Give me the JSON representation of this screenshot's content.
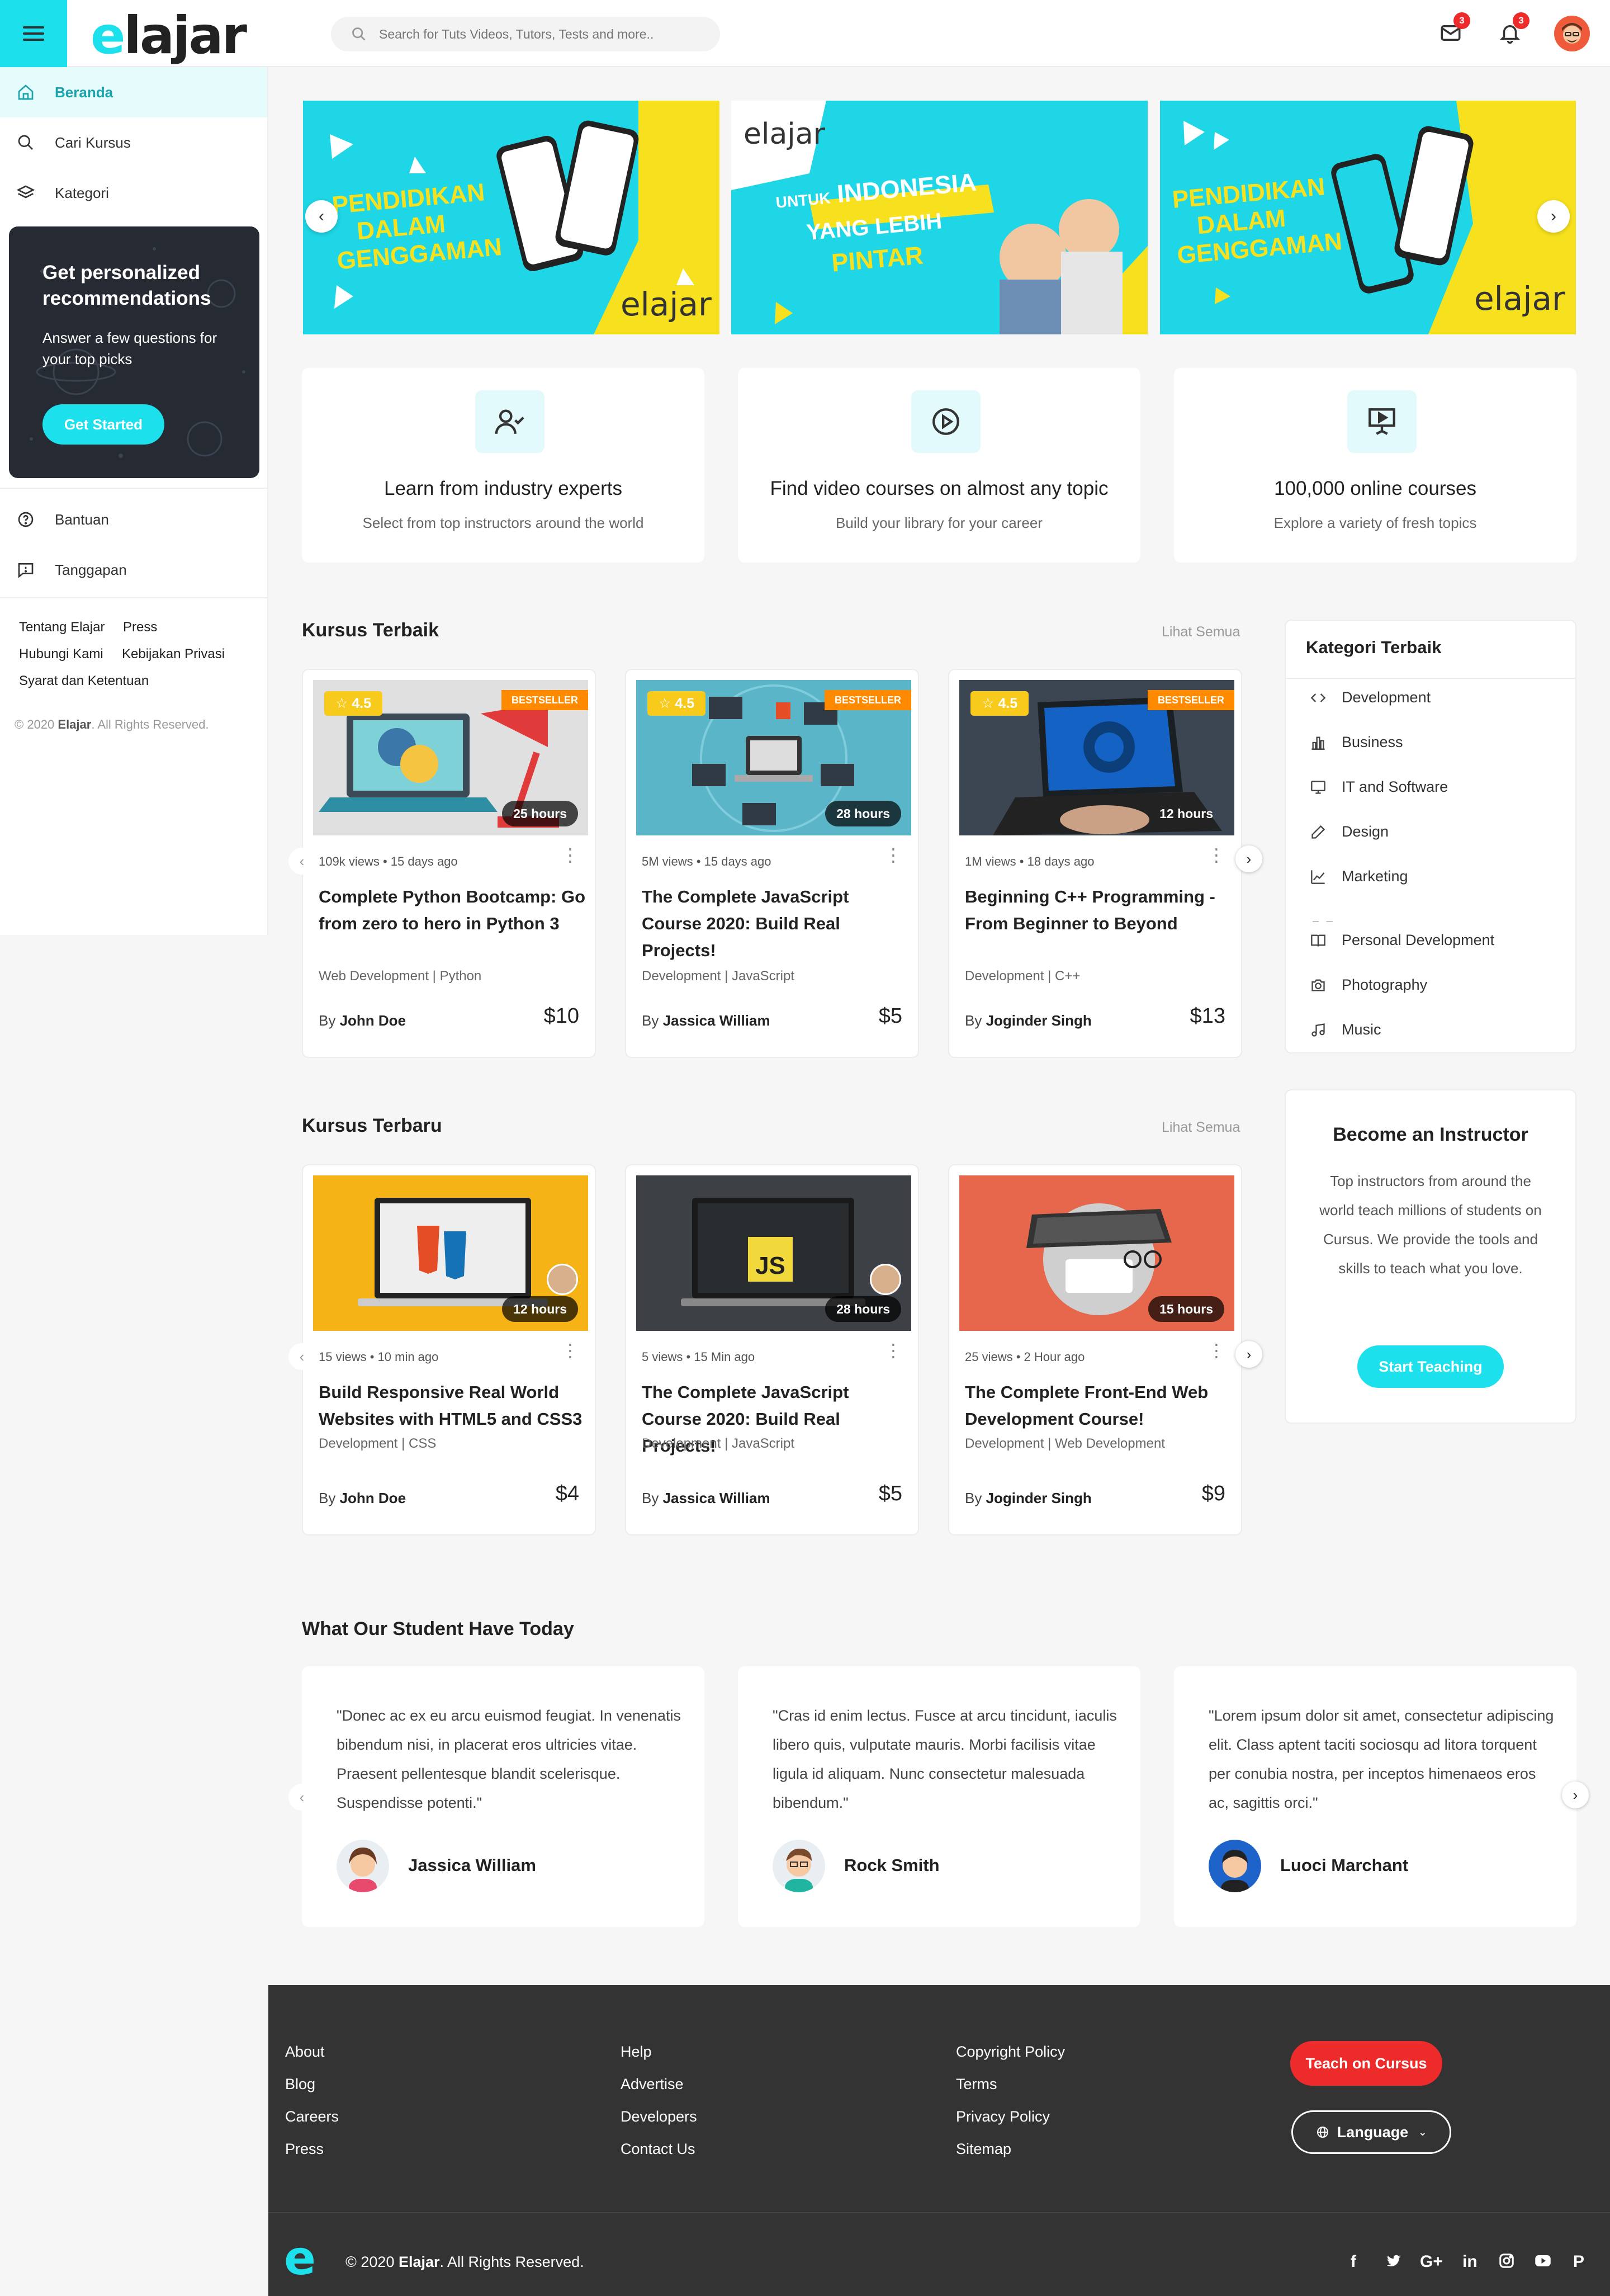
{
  "header": {
    "logo_e": "e",
    "logo_rest": "lajar",
    "search_placeholder": "Search for Tuts Videos, Tutors, Tests and more..",
    "mail_count": "3",
    "notif_count": "3"
  },
  "sidebar": {
    "nav": [
      {
        "label": "Beranda",
        "icon": "home-icon"
      },
      {
        "label": "Cari Kursus",
        "icon": "search-icon"
      },
      {
        "label": "Kategori",
        "icon": "layers-icon"
      }
    ],
    "promo": {
      "title": "Get personalized recommendations",
      "text": "Answer a few questions for your top picks",
      "button": "Get Started"
    },
    "nav2": [
      {
        "label": "Bantuan",
        "icon": "help-icon"
      },
      {
        "label": "Tanggapan",
        "icon": "feedback-icon"
      }
    ],
    "links": [
      "Tentang Elajar",
      "Press",
      "Hubungi Kami",
      "Kebijakan Privasi",
      "Syarat dan Ketentuan"
    ],
    "copyright_pre": "© 2020 ",
    "copyright_brand": "Elajar",
    "copyright_post": ". All Rights Reserved."
  },
  "banners": [
    {
      "line1": "PENDIDIKAN",
      "line2": "DALAM",
      "line3": "GENGGAMAN",
      "brand": "elajar"
    },
    {
      "brand": "elajar",
      "small": "UNTUK",
      "line1": "INDONESIA",
      "line2": "YANG LEBIH",
      "line3": "PINTAR"
    },
    {
      "line1": "PENDIDIKAN",
      "line2": "DALAM",
      "line3": "GENGGAMAN",
      "brand": "elajar"
    }
  ],
  "features": [
    {
      "title": "Learn from industry experts",
      "text": "Select from top instructors around the world",
      "icon": "user-check-icon"
    },
    {
      "title": "Find video courses on almost any topic",
      "text": "Build your library for your career",
      "icon": "play-circle-icon"
    },
    {
      "title": "100,000 online courses",
      "text": "Explore a variety of fresh topics",
      "icon": "presentation-icon"
    }
  ],
  "best": {
    "title": "Kursus Terbaik",
    "see_all": "Lihat Semua",
    "courses": [
      {
        "rating": "4.5",
        "badge": "BESTSELLER",
        "hours": "25 hours",
        "views": "109k views",
        "ago": "15 days ago",
        "title": "Complete Python Bootcamp: Go from zero to hero in Python 3",
        "category": "Web Development | Python",
        "by": "By",
        "author": "John Doe",
        "price": "$10"
      },
      {
        "rating": "4.5",
        "badge": "BESTSELLER",
        "hours": "28 hours",
        "views": "5M views",
        "ago": "15 days ago",
        "title": "The Complete JavaScript Course 2020: Build Real Projects!",
        "category": "Development | JavaScript",
        "by": "By",
        "author": "Jassica William",
        "price": "$5"
      },
      {
        "rating": "4.5",
        "badge": "BESTSELLER",
        "hours": "12 hours",
        "views": "1M views",
        "ago": "18 days ago",
        "title": "Beginning C++ Programming - From Beginner to Beyond",
        "category": "Development | C++",
        "by": "By",
        "author": "Joginder Singh",
        "price": "$13"
      }
    ]
  },
  "newest": {
    "title": "Kursus Terbaru",
    "see_all": "Lihat Semua",
    "courses": [
      {
        "hours": "12 hours",
        "views": "15 views",
        "ago": "10 min ago",
        "title": "Build Responsive Real World Websites with HTML5 and CSS3",
        "category": "Development | CSS",
        "by": "By",
        "author": "John Doe",
        "price": "$4"
      },
      {
        "hours": "28 hours",
        "views": "5 views",
        "ago": "15 Min ago",
        "title": "The Complete JavaScript Course 2020: Build Real Projects!",
        "category": "Development | JavaScript",
        "by": "By",
        "author": "Jassica William",
        "price": "$5"
      },
      {
        "hours": "15 hours",
        "views": "25 views",
        "ago": "2 Hour ago",
        "title": "The Complete Front-End Web Development Course!",
        "category": "Development | Web Development",
        "by": "By",
        "author": "Joginder Singh",
        "price": "$9"
      }
    ]
  },
  "categories": {
    "title": "Kategori Terbaik",
    "items": [
      {
        "label": "Development",
        "icon": "code-icon"
      },
      {
        "label": "Business",
        "icon": "bar-chart-icon"
      },
      {
        "label": "IT and Software",
        "icon": "monitor-icon"
      },
      {
        "label": "Design",
        "icon": "pen-icon"
      },
      {
        "label": "Marketing",
        "icon": "trending-icon"
      },
      {
        "label": "Personal Development",
        "icon": "book-icon"
      },
      {
        "label": "Photography",
        "icon": "camera-icon"
      },
      {
        "label": "Music",
        "icon": "music-icon"
      }
    ]
  },
  "instructor": {
    "title": "Become an Instructor",
    "text": "Top instructors from around the world teach millions of students on Cursus. We provide the tools and skills to teach what you love.",
    "button": "Start Teaching"
  },
  "testimonials": {
    "title": "What Our Student Have Today",
    "items": [
      {
        "quote": "\"Donec ac ex eu arcu euismod feugiat. In venenatis bibendum nisi, in placerat eros ultricies vitae. Praesent pellentesque blandit scelerisque. Suspendisse potenti.\"",
        "name": "Jassica William"
      },
      {
        "quote": "\"Cras id enim lectus. Fusce at arcu tincidunt, iaculis libero quis, vulputate mauris. Morbi facilisis vitae ligula id aliquam. Nunc consectetur malesuada bibendum.\"",
        "name": "Rock Smith"
      },
      {
        "quote": "\"Lorem ipsum dolor sit amet, consectetur adipiscing elit. Class aptent taciti sociosqu ad litora torquent per conubia nostra, per inceptos himenaeos eros ac, sagittis orci.\"",
        "name": "Luoci Marchant"
      }
    ]
  },
  "footer": {
    "col1": [
      "About",
      "Blog",
      "Careers",
      "Press"
    ],
    "col2": [
      "Help",
      "Advertise",
      "Developers",
      "Contact Us"
    ],
    "col3": [
      "Copyright Policy",
      "Terms",
      "Privacy Policy",
      "Sitemap"
    ],
    "teach": "Teach on Cursus",
    "language": "Language",
    "logo": "e",
    "copyright_pre": "© 2020 ",
    "copyright_brand": "Elajar",
    "copyright_post": ". All Rights Reserved.",
    "social": [
      "f",
      "t",
      "G+",
      "in",
      "ig",
      "yt",
      "P"
    ]
  },
  "colors": {
    "accent": "#1ce0ec",
    "danger": "#ed2b2b",
    "star": "#f8ca1c",
    "bestseller": "#ff8a00",
    "footer": "#333333"
  }
}
